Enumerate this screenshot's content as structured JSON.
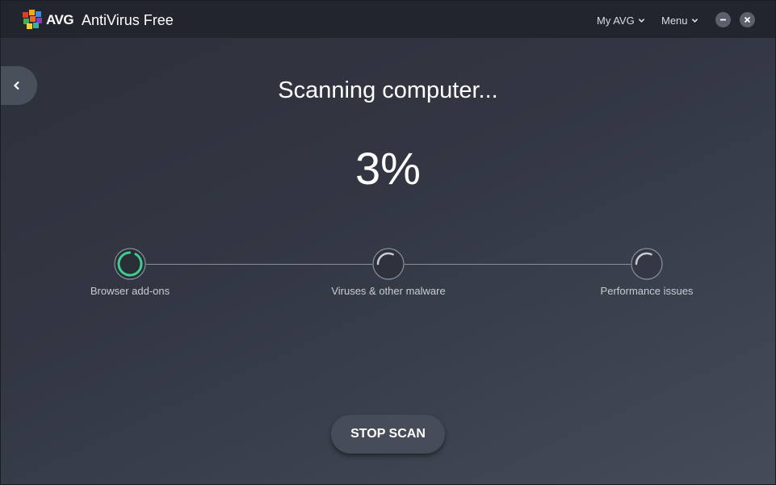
{
  "titlebar": {
    "brand": "AVG",
    "product": "AntiVirus Free",
    "my_avg_label": "My AVG",
    "menu_label": "Menu"
  },
  "scan": {
    "heading": "Scanning computer...",
    "percent_text": "3%",
    "progress": 0.03,
    "steps": [
      {
        "label": "Browser add-ons",
        "status": "active"
      },
      {
        "label": "Viruses & other malware",
        "status": "pending"
      },
      {
        "label": "Performance issues",
        "status": "pending"
      }
    ],
    "stop_label": "STOP SCAN"
  },
  "colors": {
    "accent_green": "#3ecf8e",
    "titlebar_bg": "#22252d",
    "body_bg": "#2f333d"
  },
  "icons": {
    "logo": "avg-logo-icon",
    "back": "chevron-left-icon",
    "dropdown": "chevron-down-icon",
    "minimize": "minimize-icon",
    "close": "close-icon",
    "step_active": "spinner-active-icon",
    "step_pending": "spinner-pending-icon"
  }
}
